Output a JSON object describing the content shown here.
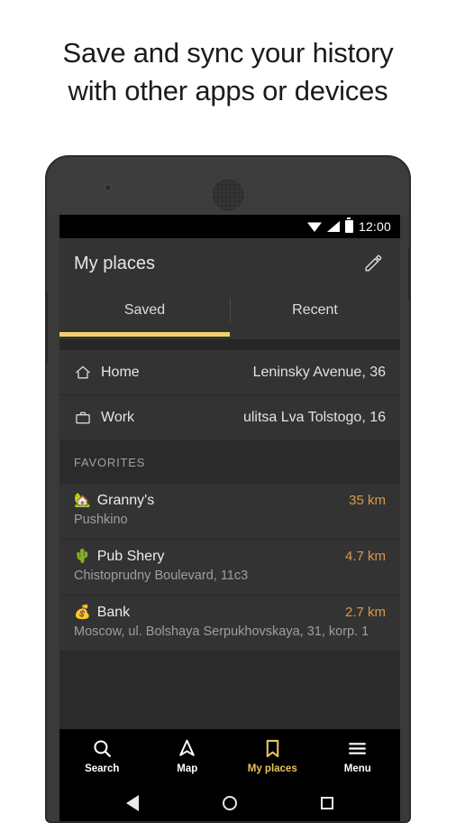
{
  "promo": {
    "line1": "Save and sync your history",
    "line2": "with other apps or devices"
  },
  "statusbar": {
    "clock": "12:00",
    "icons": [
      "wifi-icon",
      "signal-icon",
      "battery-icon"
    ]
  },
  "header": {
    "title": "My places",
    "edit_icon": "pencil-icon"
  },
  "tabs": [
    {
      "label": "Saved",
      "active": true
    },
    {
      "label": "Recent",
      "active": false
    }
  ],
  "quick_places": [
    {
      "icon": "home-icon",
      "label": "Home",
      "address": "Leninsky Avenue, 36"
    },
    {
      "icon": "briefcase-icon",
      "label": "Work",
      "address": "ulitsa Lva Tolstogo, 16"
    }
  ],
  "favorites_section": {
    "title": "FAVORITES",
    "items": [
      {
        "emoji": "🏡",
        "name": "Granny's",
        "distance": "35 km",
        "address": "Pushkino"
      },
      {
        "emoji": "🌵",
        "name": "Pub Shery",
        "distance": "4.7 km",
        "address": "Chistoprudny Boulevard, 11c3"
      },
      {
        "emoji": "💰",
        "name": "Bank",
        "distance": "2.7 km",
        "address": "Moscow, ul. Bolshaya Serpukhovskaya, 31, korp. 1"
      }
    ]
  },
  "bottom_nav": [
    {
      "icon": "search-icon",
      "label": "Search",
      "active": false
    },
    {
      "icon": "navigation-arrow-icon",
      "label": "Map",
      "active": false
    },
    {
      "icon": "bookmark-icon",
      "label": "My places",
      "active": true
    },
    {
      "icon": "hamburger-menu-icon",
      "label": "Menu",
      "active": false
    }
  ],
  "system_nav": {
    "back": "back-triangle-icon",
    "home": "home-circle-icon",
    "recents": "recents-square-icon"
  },
  "colors": {
    "accent_yellow": "#f2d06b",
    "distance_orange": "#d79a4a",
    "nav_active": "#e9c45c",
    "surface": "#333333",
    "background": "#2b2b2b"
  }
}
